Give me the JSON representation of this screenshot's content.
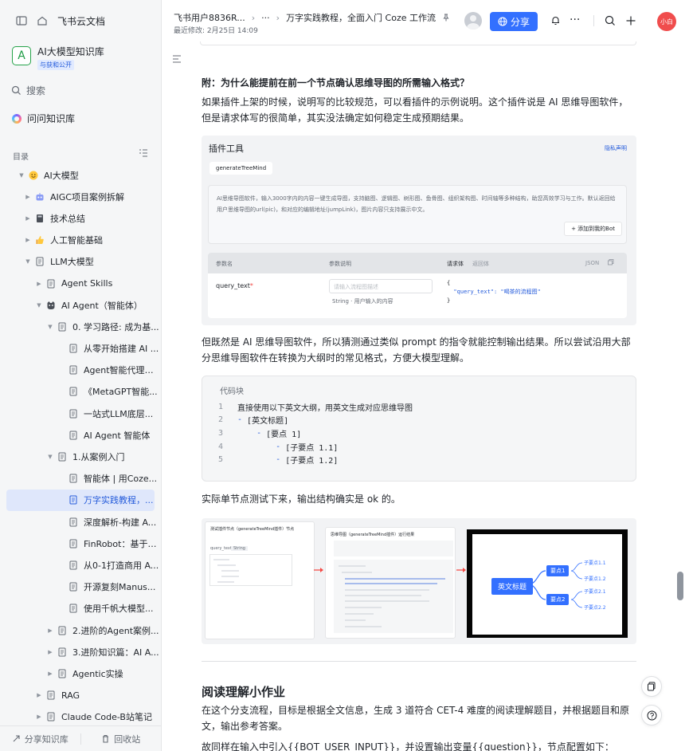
{
  "app": {
    "title": "飞书云文档"
  },
  "knowledge_base": {
    "name": "AI大模型知识库",
    "logo_letter": "A",
    "badge": "与获和公开"
  },
  "sidebar": {
    "search_label": "搜索",
    "ask_label": "问问知识库",
    "toc_label": "目录",
    "tree": [
      {
        "label": "AI大模型",
        "depth": 0,
        "arrow": "down",
        "icon": "emoji-smile"
      },
      {
        "label": "AIGC项目案例拆解",
        "depth": 1,
        "arrow": "right",
        "icon": "emoji-robot"
      },
      {
        "label": "技术总结",
        "depth": 1,
        "arrow": "right",
        "icon": "emoji-notebook"
      },
      {
        "label": "人工智能基础",
        "depth": 1,
        "arrow": "right",
        "icon": "emoji-thumb"
      },
      {
        "label": "LLM大模型",
        "depth": 1,
        "arrow": "down",
        "icon": "doc"
      },
      {
        "label": "Agent Skills",
        "depth": 2,
        "arrow": "right",
        "icon": "doc"
      },
      {
        "label": "AI Agent（智能体）",
        "depth": 2,
        "arrow": "down",
        "icon": "emoji-cat"
      },
      {
        "label": "0. 学习路径: 成为基...",
        "depth": 3,
        "arrow": "down",
        "icon": "doc"
      },
      {
        "label": "从零开始搭建 AI ...",
        "depth": 4,
        "arrow": "none",
        "icon": "doc"
      },
      {
        "label": "Agent智能代理开...",
        "depth": 4,
        "arrow": "none",
        "icon": "doc"
      },
      {
        "label": "《MetaGPT智能...",
        "depth": 4,
        "arrow": "none",
        "icon": "doc"
      },
      {
        "label": "一站式LLM底层...",
        "depth": 4,
        "arrow": "none",
        "icon": "doc"
      },
      {
        "label": "AI Agent 智能体",
        "depth": 4,
        "arrow": "none",
        "icon": "doc"
      },
      {
        "label": "1.从案例入门",
        "depth": 3,
        "arrow": "down",
        "icon": "doc"
      },
      {
        "label": "智能体 | 用Coze...",
        "depth": 4,
        "arrow": "none",
        "icon": "doc"
      },
      {
        "label": "万字实践教程，...",
        "depth": 4,
        "arrow": "none",
        "icon": "doc",
        "active": true
      },
      {
        "label": "深度解析-构建 A...",
        "depth": 4,
        "arrow": "none",
        "icon": "doc"
      },
      {
        "label": "FinRobot：基于L...",
        "depth": 4,
        "arrow": "none",
        "icon": "doc"
      },
      {
        "label": "从0-1打造商用 A...",
        "depth": 4,
        "arrow": "none",
        "icon": "doc"
      },
      {
        "label": "开源复刻Manus...",
        "depth": 4,
        "arrow": "none",
        "icon": "doc"
      },
      {
        "label": "使用千帆大模型...",
        "depth": 4,
        "arrow": "none",
        "icon": "doc"
      },
      {
        "label": "2.进阶的Agent案例...",
        "depth": 3,
        "arrow": "right",
        "icon": "doc"
      },
      {
        "label": "3.进阶知识篇：AI A...",
        "depth": 3,
        "arrow": "right",
        "icon": "doc"
      },
      {
        "label": "Agentic实操",
        "depth": 3,
        "arrow": "right",
        "icon": "doc"
      },
      {
        "label": "RAG",
        "depth": 2,
        "arrow": "right",
        "icon": "doc"
      },
      {
        "label": "Claude Code-B站笔记",
        "depth": 2,
        "arrow": "right",
        "icon": "doc"
      }
    ],
    "share_label": "分享知识库",
    "trash_label": "回收站"
  },
  "header": {
    "breadcrumb_user": "飞书用户8836R...",
    "breadcrumb_more": "···",
    "doc_title": "万字实践教程，全面入门 Coze 工作流",
    "modified": "最近修改: 2月25日 14:09",
    "share_label": "分享",
    "user_avatar_text": "小白",
    "accent": "#3370ff"
  },
  "content": {
    "heading_appendix": "附：为什么能提前在前一个节点确认思维导图的所需输入格式？",
    "para_1": "如果插件上架的时候，说明写的比较规范，可以看插件的示例说明。这个插件说是 AI 思维导图软件，但是请求体写的很简单，其实没法确定如何稳定生成预期结果。",
    "plugin_shot": {
      "title": "插件工具",
      "privacy": "隐私声明",
      "tag": "generateTreeMind",
      "desc": "AI思维导图软件，输入3000字内的内容一键生成导图，支持脑图、逻辑图、树形图、鱼骨图、组织架构图、时间轴等多种结构，助您高效学习与工作。默认返回给用户思维导图的url(pic)，和对应的编辑地址(jumpLink)，图片内容只支持展示中文。",
      "add_button": "+ 添加到我的Bot",
      "col_param": "参数名",
      "col_desc": "参数说明",
      "col_request": "请求体",
      "col_response": "返回体",
      "col_json": "JSON",
      "param_name": "query_text",
      "param_required": "*",
      "param_placeholder": "请输入流程图描述",
      "param_type": "String · 用户输入的内容",
      "json_open": "{",
      "json_line": "  \"query_text\": \"喝茶的流程图\"",
      "json_close": "}"
    },
    "para_2": "但既然是 AI 思维导图软件，所以猜测通过类似 prompt 的指令就能控制输出结果。所以尝试沿用大部分思维导图软件在转换为大纲时的常见格式，方便大模型理解。",
    "code_label": "代码块",
    "code_lines": [
      {
        "n": "1",
        "indent": "",
        "dash": "",
        "text": "直接使用以下英文大纲，用英文生成对应思维导图"
      },
      {
        "n": "2",
        "indent": "",
        "dash": "- ",
        "text": "[英文标题]"
      },
      {
        "n": "3",
        "indent": "    ",
        "dash": "- ",
        "text": "[要点 1]"
      },
      {
        "n": "4",
        "indent": "        ",
        "dash": "- ",
        "text": "[子要点 1.1]"
      },
      {
        "n": "5",
        "indent": "        ",
        "dash": "- ",
        "text": "[子要点 1.2]"
      }
    ],
    "para_3": "实际单节点测试下来，输出结构确实是 ok 的。",
    "flow_shot": {
      "panel1_title": "测试插件节点（generateTreeMind插件）节点",
      "panel1_row": "query_text",
      "panel1_type": "String",
      "panel2_title": "思维导图（generateTreeMind插件）运行结果",
      "root_label": "英文标题",
      "mid_1": "要点1",
      "mid_2": "要点2",
      "leaves": [
        "子要点1.1",
        "子要点1.2",
        "子要点2.1",
        "子要点2.2"
      ]
    },
    "heading_reading": "阅读理解小作业",
    "para_4": "在这个分支流程，目标是根据全文信息，生成 3 道符合 CET-4 难度的阅读理解题目，并根据题目和原文，输出参考答案。",
    "para_5": "故同样在输入中引入{{BOT_USER_INPUT}}，并设置输出变量{{question}}，节点配置如下："
  }
}
